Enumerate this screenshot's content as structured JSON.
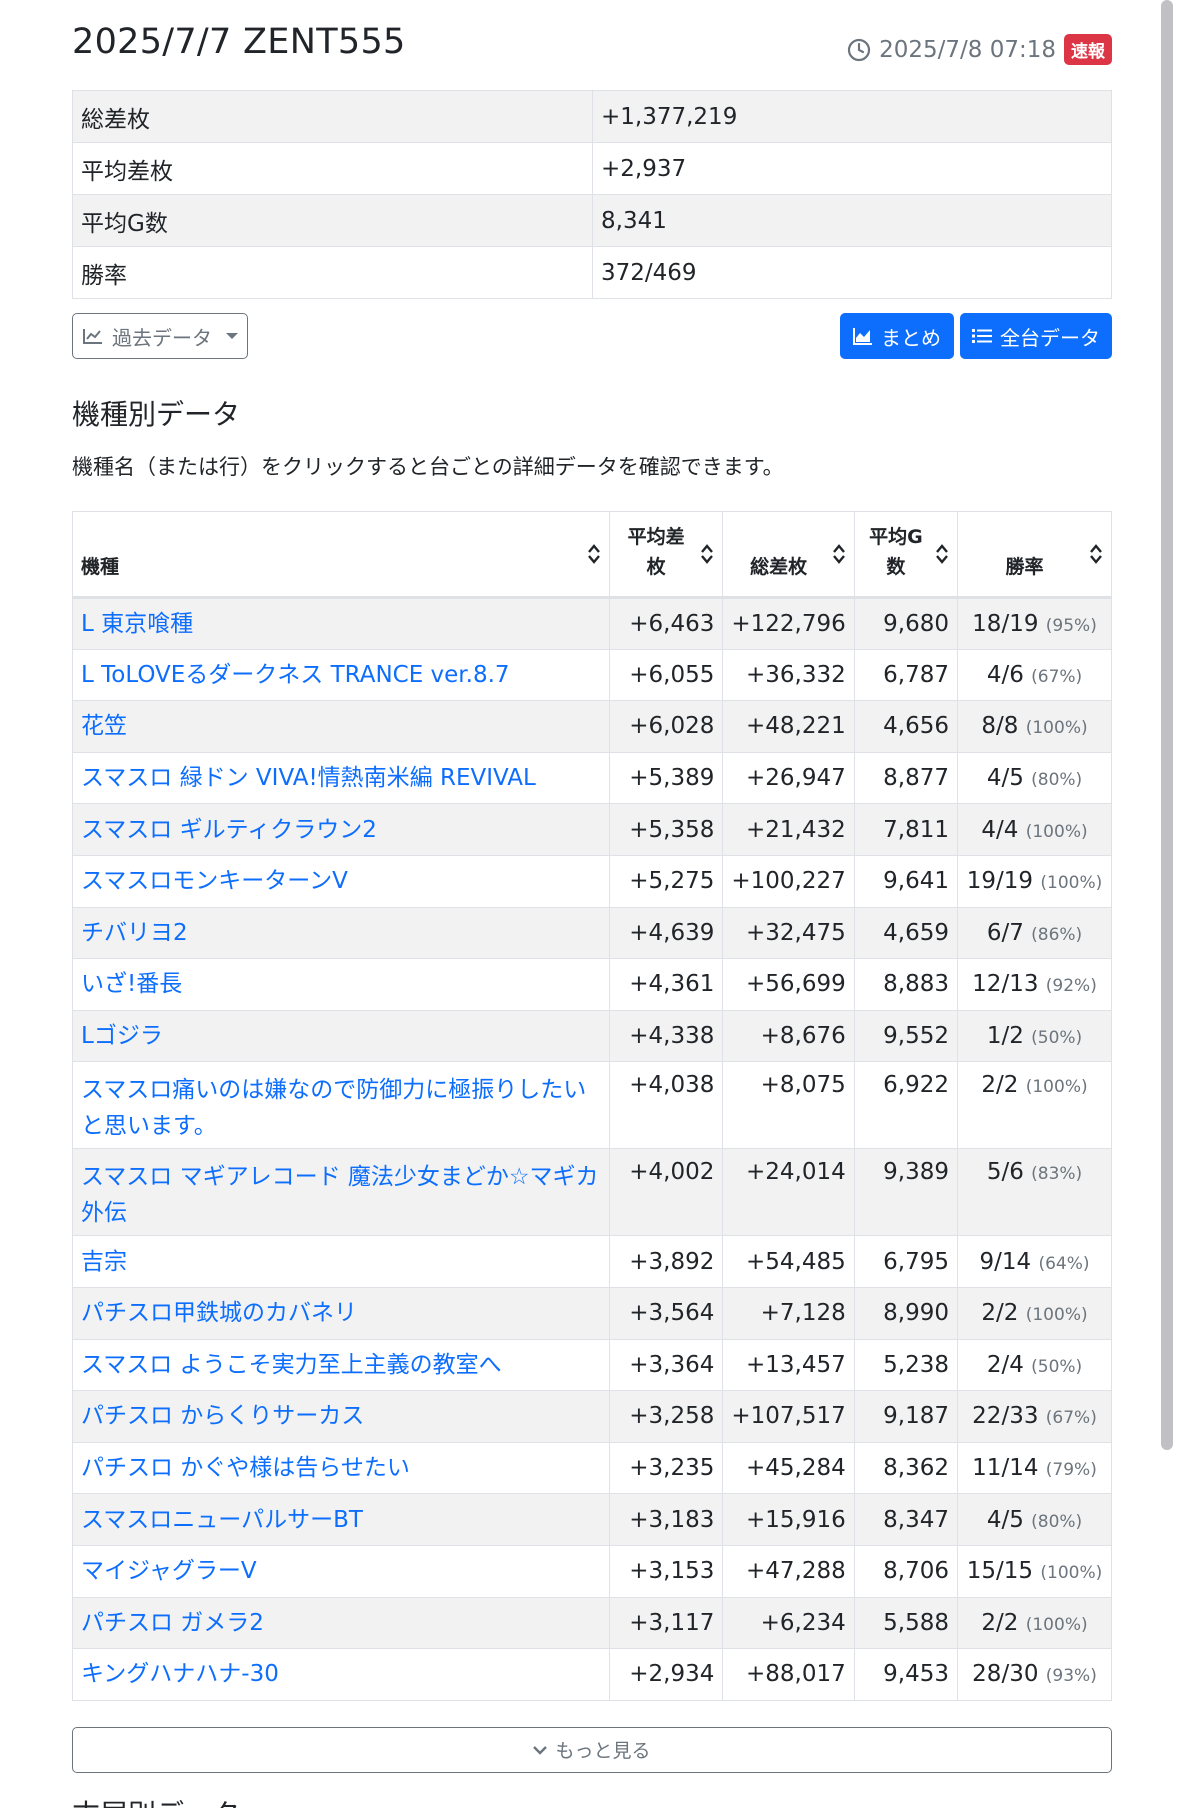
{
  "header": {
    "title": "2025/7/7 ZENT555",
    "updated": "2025/7/8 07:18",
    "badge": "速報"
  },
  "summary": [
    {
      "label": "総差枚",
      "value": "+1,377,219"
    },
    {
      "label": "平均差枚",
      "value": "+2,937"
    },
    {
      "label": "平均G数",
      "value": "8,341"
    },
    {
      "label": "勝率",
      "value": "372/469"
    }
  ],
  "buttons": {
    "past_data": "過去データ",
    "summary": "まとめ",
    "all_data": "全台データ"
  },
  "machine_section": {
    "title": "機種別データ",
    "description": "機種名（または行）をクリックすると台ごとの詳細データを確認できます。",
    "headers": {
      "name": "機種",
      "avg_diff_1": "平均差",
      "avg_diff_2": "枚",
      "total_diff": "総差枚",
      "avg_games_1": "平均G",
      "avg_games_2": "数",
      "win_rate": "勝率"
    },
    "rows": [
      {
        "name": "L 東京喰種",
        "avg": "+6,463",
        "total": "+122,796",
        "games": "9,680",
        "win": "18/19",
        "pct": "(95%)"
      },
      {
        "name": "L ToLOVEるダークネス TRANCE ver.8.7",
        "avg": "+6,055",
        "total": "+36,332",
        "games": "6,787",
        "win": "4/6",
        "pct": "(67%)"
      },
      {
        "name": "花笠",
        "avg": "+6,028",
        "total": "+48,221",
        "games": "4,656",
        "win": "8/8",
        "pct": "(100%)"
      },
      {
        "name": "スマスロ 緑ドン VIVA!情熱南米編 REVIVAL",
        "avg": "+5,389",
        "total": "+26,947",
        "games": "8,877",
        "win": "4/5",
        "pct": "(80%)"
      },
      {
        "name": "スマスロ ギルティクラウン2",
        "avg": "+5,358",
        "total": "+21,432",
        "games": "7,811",
        "win": "4/4",
        "pct": "(100%)"
      },
      {
        "name": "スマスロモンキーターンV",
        "avg": "+5,275",
        "total": "+100,227",
        "games": "9,641",
        "win": "19/19",
        "pct": "(100%)"
      },
      {
        "name": "チバリヨ2",
        "avg": "+4,639",
        "total": "+32,475",
        "games": "4,659",
        "win": "6/7",
        "pct": "(86%)"
      },
      {
        "name": "いざ!番長",
        "avg": "+4,361",
        "total": "+56,699",
        "games": "8,883",
        "win": "12/13",
        "pct": "(92%)"
      },
      {
        "name": "Lゴジラ",
        "avg": "+4,338",
        "total": "+8,676",
        "games": "9,552",
        "win": "1/2",
        "pct": "(50%)"
      },
      {
        "name": "スマスロ痛いのは嫌なので防御力に極振りしたいと思います。",
        "avg": "+4,038",
        "total": "+8,075",
        "games": "6,922",
        "win": "2/2",
        "pct": "(100%)"
      },
      {
        "name": "スマスロ マギアレコード 魔法少女まどか☆マギカ外伝",
        "avg": "+4,002",
        "total": "+24,014",
        "games": "9,389",
        "win": "5/6",
        "pct": "(83%)"
      },
      {
        "name": "吉宗",
        "avg": "+3,892",
        "total": "+54,485",
        "games": "6,795",
        "win": "9/14",
        "pct": "(64%)"
      },
      {
        "name": "パチスロ甲鉄城のカバネリ",
        "avg": "+3,564",
        "total": "+7,128",
        "games": "8,990",
        "win": "2/2",
        "pct": "(100%)"
      },
      {
        "name": "スマスロ ようこそ実力至上主義の教室へ",
        "avg": "+3,364",
        "total": "+13,457",
        "games": "5,238",
        "win": "2/4",
        "pct": "(50%)"
      },
      {
        "name": "パチスロ からくりサーカス",
        "avg": "+3,258",
        "total": "+107,517",
        "games": "9,187",
        "win": "22/33",
        "pct": "(67%)"
      },
      {
        "name": "パチスロ かぐや様は告らせたい",
        "avg": "+3,235",
        "total": "+45,284",
        "games": "8,362",
        "win": "11/14",
        "pct": "(79%)"
      },
      {
        "name": "スマスロニューパルサーBT",
        "avg": "+3,183",
        "total": "+15,916",
        "games": "8,347",
        "win": "4/5",
        "pct": "(80%)"
      },
      {
        "name": "マイジャグラーV",
        "avg": "+3,153",
        "total": "+47,288",
        "games": "8,706",
        "win": "15/15",
        "pct": "(100%)"
      },
      {
        "name": "パチスロ ガメラ2",
        "avg": "+3,117",
        "total": "+6,234",
        "games": "5,588",
        "win": "2/2",
        "pct": "(100%)"
      },
      {
        "name": "キングハナハナ-30",
        "avg": "+2,934",
        "total": "+88,017",
        "games": "9,453",
        "win": "28/30",
        "pct": "(93%)"
      }
    ],
    "more": "もっと見る"
  },
  "tail_section": {
    "title": "末尾別データ"
  }
}
